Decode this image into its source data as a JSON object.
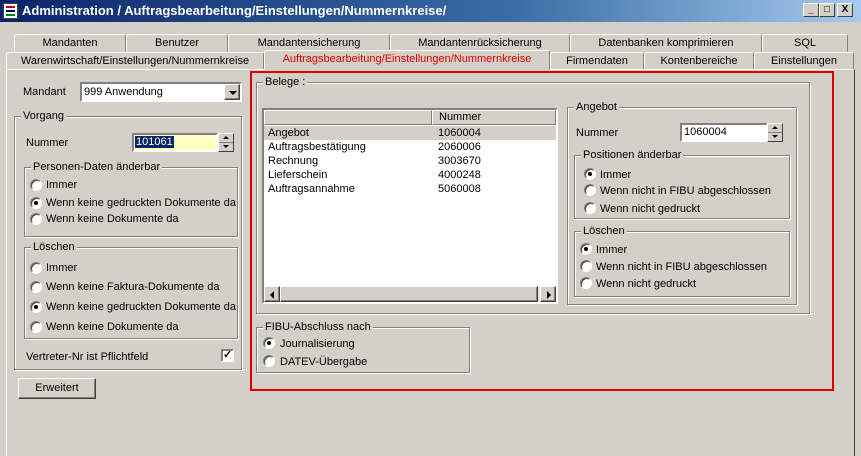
{
  "window": {
    "title": "Administration / Auftragsbearbeitung/Einstellungen/Nummernkreise/",
    "min": "_",
    "max": "□",
    "close": "X"
  },
  "tabs_row1": [
    "Mandanten",
    "Benutzer",
    "Mandantensicherung",
    "Mandantenrücksicherung",
    "Datenbanken komprimieren",
    "SQL"
  ],
  "tabs_row2": [
    "Warenwirtschaft/Einstellungen/Nummernkreise",
    "Auftragsbearbeitung/Einstellungen/Nummernkreise",
    "Firmendaten",
    "Kontenbereiche",
    "Einstellungen"
  ],
  "left": {
    "mandant_label": "Mandant",
    "mandant_value": "999 Anwendung",
    "vorgang": {
      "legend": "Vorgang",
      "nummer_label": "Nummer",
      "nummer_value": "101061",
      "personen": {
        "legend": "Personen-Daten änderbar",
        "options": [
          "Immer",
          "Wenn keine gedruckten Dokumente da",
          "Wenn keine  Dokumente da"
        ],
        "selected": 1
      },
      "loeschen": {
        "legend": "Löschen",
        "options": [
          "Immer",
          "Wenn keine  Faktura-Dokumente da",
          "Wenn keine gedruckten Dokumente da",
          "Wenn keine  Dokumente da"
        ],
        "selected": 2
      },
      "vertreter_label": "Vertreter-Nr ist Pflichtfeld",
      "vertreter_checked": true
    },
    "erweitert": "Erweitert"
  },
  "belege": {
    "legend": "Belege :",
    "col_name": "",
    "col_nummer": "Nummer",
    "rows": [
      {
        "name": "Angebot",
        "nummer": "1060004"
      },
      {
        "name": "Auftragsbestätigung",
        "nummer": "2060006"
      },
      {
        "name": "Rechnung",
        "nummer": "3003670"
      },
      {
        "name": "Lieferschein",
        "nummer": "4000248"
      },
      {
        "name": "Auftragsannahme",
        "nummer": "5060008"
      }
    ],
    "selected_row": 0
  },
  "angebot": {
    "legend": "Angebot",
    "nummer_label": "Nummer",
    "nummer_value": "1060004",
    "positionen": {
      "legend": "Positionen änderbar",
      "options": [
        "Immer",
        "Wenn nicht in FIBU abgeschlossen",
        "Wenn nicht gedruckt"
      ],
      "selected": 0
    },
    "loeschen": {
      "legend": "Löschen",
      "options": [
        "Immer",
        "Wenn nicht in FIBU abgeschlossen",
        "Wenn nicht gedruckt"
      ],
      "selected": 0
    }
  },
  "fibu": {
    "legend": "FIBU-Abschluss nach",
    "options": [
      "Journalisierung",
      "DATEV-Übergabe"
    ],
    "selected": 0
  },
  "colors": {
    "highlight_border": "#e00000",
    "active_tab_text": "#e00000",
    "selected_input_bg": "#0a246a"
  }
}
